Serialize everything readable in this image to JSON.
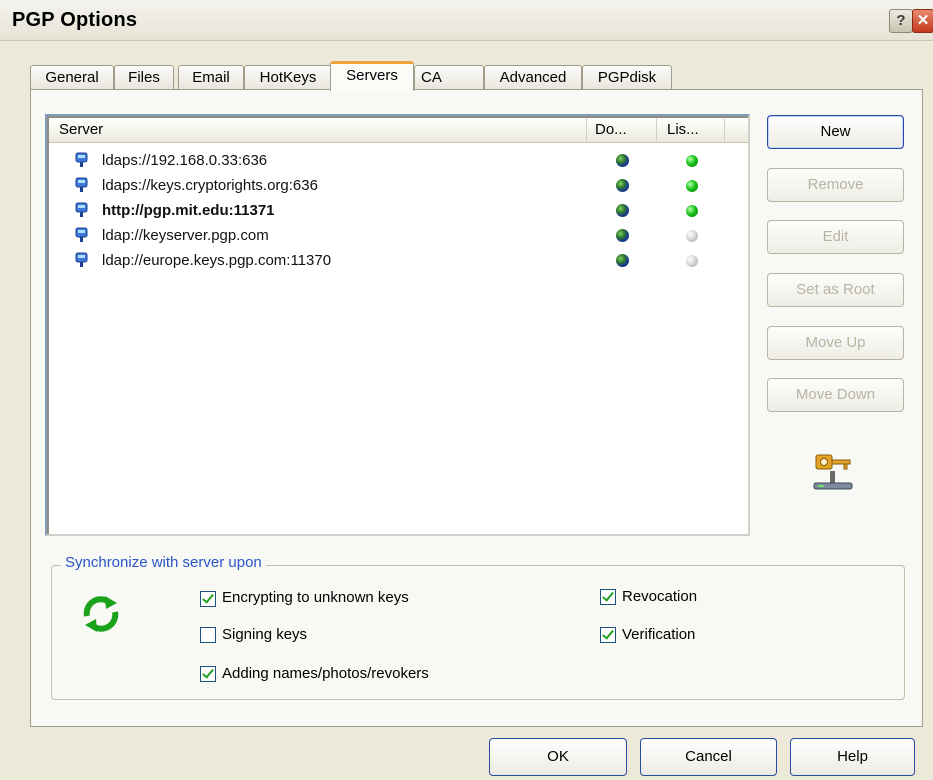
{
  "window": {
    "title": "PGP Options"
  },
  "tabs": [
    {
      "label": "General"
    },
    {
      "label": "Files"
    },
    {
      "label": "Email"
    },
    {
      "label": "HotKeys"
    },
    {
      "label": "Servers",
      "active": true
    },
    {
      "label": "CA"
    },
    {
      "label": "Advanced"
    },
    {
      "label": "PGPdisk"
    }
  ],
  "server_list": {
    "columns": [
      "Server",
      "Do...",
      "Lis..."
    ],
    "rows": [
      {
        "name": "ldaps://192.168.0.33:636",
        "bold": false,
        "listed": "green"
      },
      {
        "name": "ldaps://keys.cryptorights.org:636",
        "bold": false,
        "listed": "green"
      },
      {
        "name": "http://pgp.mit.edu:11371",
        "bold": true,
        "listed": "green"
      },
      {
        "name": "ldap://keyserver.pgp.com",
        "bold": false,
        "listed": "gray"
      },
      {
        "name": "ldap://europe.keys.pgp.com:11370",
        "bold": false,
        "listed": "gray"
      }
    ]
  },
  "side_buttons": {
    "new": "New",
    "remove": "Remove",
    "edit": "Edit",
    "set_as_root": "Set as Root",
    "move_up": "Move Up",
    "move_down": "Move Down"
  },
  "sync": {
    "legend": "Synchronize with server upon",
    "options": {
      "encrypting": {
        "label": "Encrypting to unknown keys",
        "checked": true
      },
      "signing": {
        "label": "Signing keys",
        "checked": false
      },
      "adding": {
        "label": "Adding names/photos/revokers",
        "checked": true
      },
      "revocation": {
        "label": "Revocation",
        "checked": true
      },
      "verification": {
        "label": "Verification",
        "checked": true
      }
    }
  },
  "footer": {
    "ok": "OK",
    "cancel": "Cancel",
    "help": "Help"
  },
  "colors": {
    "tab_accent": "#f0a23a",
    "group_legend": "#2b54c9",
    "listed_green": "#19c219"
  }
}
